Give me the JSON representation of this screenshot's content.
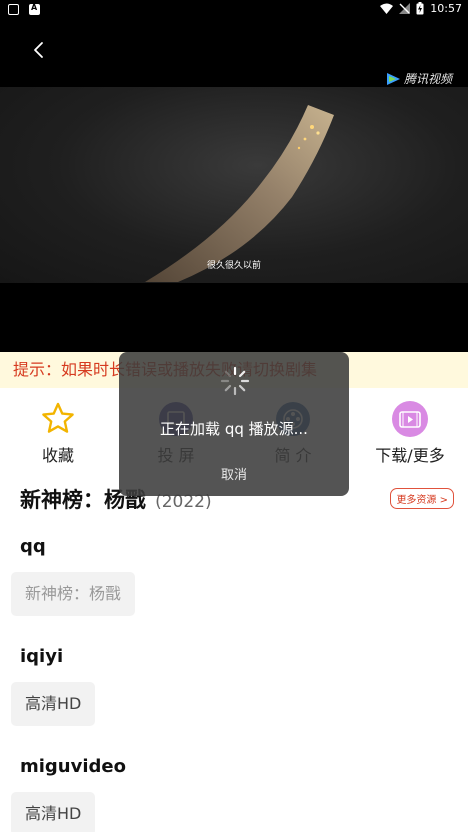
{
  "status_bar": {
    "time": "10:57"
  },
  "player": {
    "brand_label": "腾讯视频",
    "subtitle": "很久很久以前"
  },
  "hint": "提示：如果时长错误或播放失败请切换剧集",
  "actions": [
    {
      "label": "收藏",
      "icon": "star-icon"
    },
    {
      "label": "投 屏",
      "icon": "cast-icon"
    },
    {
      "label": "简 介",
      "icon": "film-reel-icon"
    },
    {
      "label": "下载/更多",
      "icon": "video-download-icon"
    }
  ],
  "show": {
    "title": "新神榜：杨戬",
    "year": "(2022)",
    "more_resources": "更多资源 >"
  },
  "sources": [
    {
      "name": "qq",
      "episode": "新神榜：杨戬"
    },
    {
      "name": "iqiyi",
      "episode": "高清HD"
    },
    {
      "name": "miguvideo",
      "episode": "高清HD"
    }
  ],
  "loading_dialog": {
    "message": "正在加载 qq 播放源...",
    "cancel": "取消"
  },
  "colors": {
    "hint_text": "#d63a1f",
    "hint_bg": "#fff9dd",
    "star": "#f2b400",
    "download_icon": "#c85ad8"
  }
}
